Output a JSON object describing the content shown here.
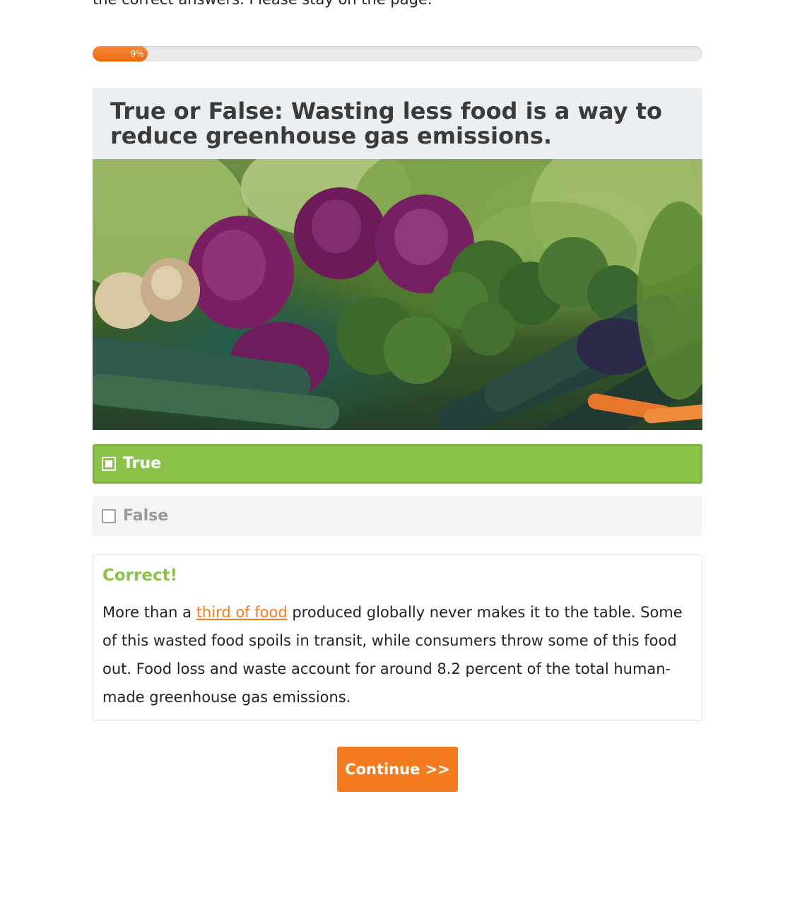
{
  "intro": {
    "text": "the correct answers. Please stay on the page."
  },
  "progress": {
    "percent": 9,
    "label": "9%"
  },
  "question": {
    "title": "True or False: Wasting less food is a way to reduce greenhouse gas emissions.",
    "image_icon": "vegetables-photo"
  },
  "answers": [
    {
      "label": "True",
      "selected": true,
      "state": "correct"
    },
    {
      "label": "False",
      "selected": false,
      "state": "unselected"
    }
  ],
  "feedback": {
    "heading": "Correct!",
    "text_before_link": "More than a ",
    "link_text": "third of food",
    "text_after_link": " produced globally never makes it to the table. Some of this wasted food spoils in transit, while consumers throw some of this food out. Food loss and waste account for around 8.2 percent of the total human-made greenhouse gas emissions."
  },
  "continue_button": {
    "label": "Continue >>"
  },
  "colors": {
    "accent_orange": "#f47b20",
    "correct_green": "#8bc34a",
    "question_bg": "#eceff1",
    "answer_bg": "#f3f4f5"
  }
}
